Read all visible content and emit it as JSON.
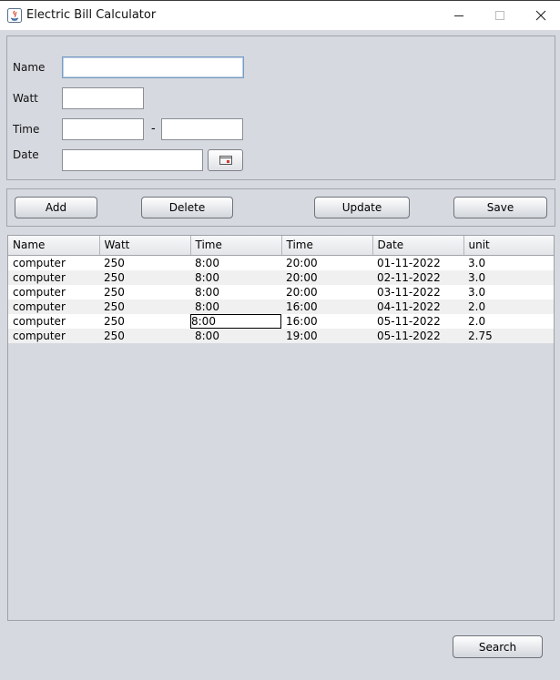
{
  "window": {
    "title": "Electric Bill Calculator",
    "icons": [
      "java-icon",
      "minimize-icon",
      "maximize-icon",
      "close-icon"
    ]
  },
  "form": {
    "name_label": "Name",
    "watt_label": "Watt",
    "time_label": "Time",
    "time_separator": "-",
    "date_label": "Date",
    "name_value": "",
    "watt_value": "",
    "time_start_value": "",
    "time_end_value": "",
    "date_value": "",
    "date_picker_icon": "calendar-icon"
  },
  "toolbar": {
    "add_label": "Add",
    "delete_label": "Delete",
    "update_label": "Update",
    "save_label": "Save"
  },
  "table": {
    "columns": [
      "Name",
      "Watt",
      "Time",
      "Time",
      "Date",
      "unit"
    ],
    "rows": [
      [
        "computer",
        "250",
        "8:00",
        "20:00",
        "01-11-2022",
        "3.0"
      ],
      [
        "computer",
        "250",
        "8:00",
        "20:00",
        "02-11-2022",
        "3.0"
      ],
      [
        "computer",
        "250",
        "8:00",
        "20:00",
        "03-11-2022",
        "3.0"
      ],
      [
        "computer",
        "250",
        "8:00",
        "16:00",
        "04-11-2022",
        "2.0"
      ],
      [
        "computer",
        "250",
        "8:00",
        "16:00",
        "05-11-2022",
        "2.0"
      ],
      [
        "computer",
        "250",
        "8:00",
        "19:00",
        "05-11-2022",
        "2.75"
      ]
    ]
  },
  "footer": {
    "search_label": "Search"
  }
}
